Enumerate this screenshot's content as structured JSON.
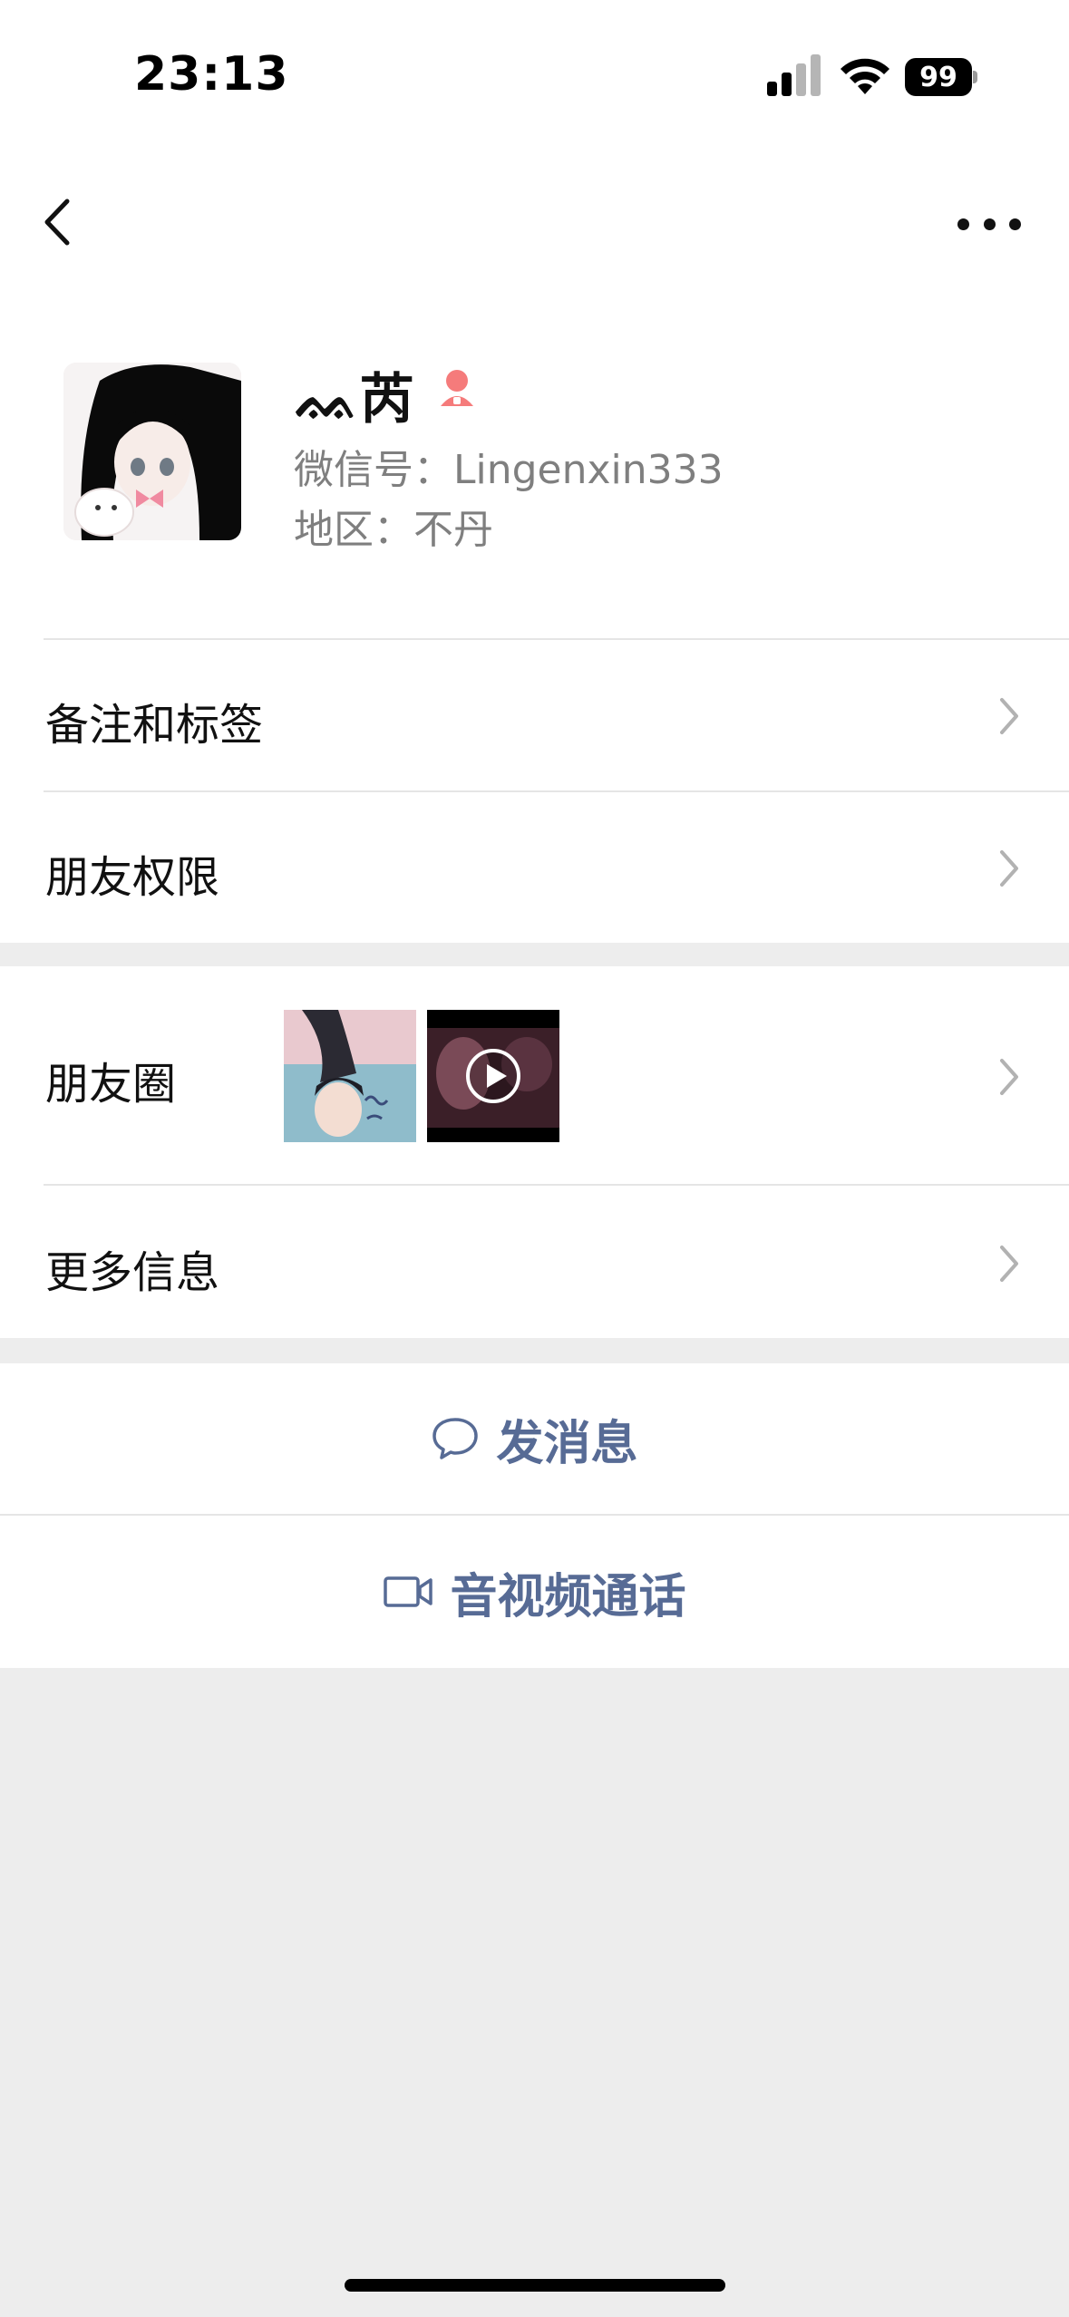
{
  "status_bar": {
    "time": "23:13",
    "battery": "99",
    "signal_icon": "cellular-signal-icon",
    "wifi_icon": "wifi-icon"
  },
  "nav": {
    "back_icon": "chevron-left-icon",
    "more_icon": "more-dots-icon"
  },
  "profile": {
    "nickname": "ᨐ芮",
    "gender_icon": "female-icon",
    "gender_color": "#f57b7b",
    "wechat_id": "微信号：Lingenxin333",
    "region": "地区：不丹"
  },
  "rows": {
    "remarks_tags": "备注和标签",
    "friend_permissions": "朋友权限",
    "moments": "朋友圈",
    "more_info": "更多信息"
  },
  "actions": {
    "send_message": "发消息",
    "av_call": "音视频通话",
    "accent_color": "#576b95"
  }
}
